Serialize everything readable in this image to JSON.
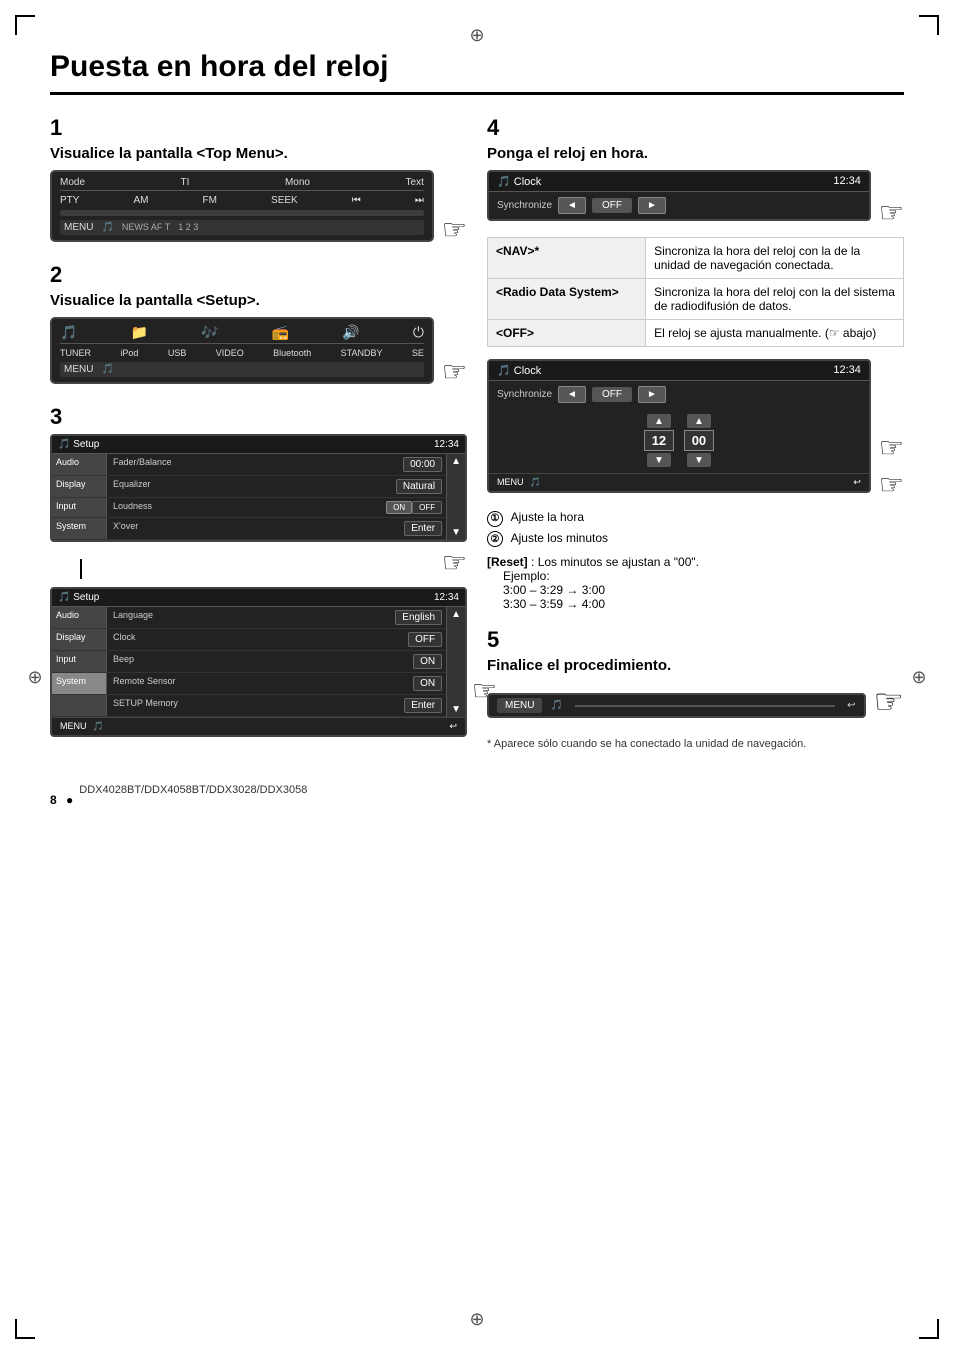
{
  "page": {
    "title": "Puesta en hora del reloj",
    "page_number": "8",
    "models": "DDX4028BT/DDX4058BT/DDX3028/DDX3058"
  },
  "step1": {
    "number": "1",
    "title": "Visualice la pantalla <Top Menu>.",
    "screen": {
      "top_items": [
        "Mode",
        "TI",
        "Mono",
        "Text"
      ],
      "radio_items": [
        "PTY",
        "AM",
        "FM",
        "SEEK",
        "⏮",
        "⏭"
      ],
      "bar_label": "MENU"
    }
  },
  "step2": {
    "number": "2",
    "title": "Visualice la pantalla <Setup>.",
    "screen": {
      "icons_row": [
        "🎵",
        "📁",
        "🎶",
        "📻",
        "🔊",
        "⏻"
      ],
      "bottom_items": [
        "TUNER",
        "iPod",
        "USB",
        "VIDEO",
        "Bluetooth",
        "STANDBY",
        "SE"
      ],
      "bar_label": "MENU"
    }
  },
  "step3": {
    "number": "3",
    "screen1": {
      "title": "Setup",
      "time": "12:34",
      "rows": [
        {
          "cat": "Audio",
          "item": "Fader/Balance",
          "val": "00:00"
        },
        {
          "cat": "Display",
          "item": "Equalizer",
          "val": "Natural"
        },
        {
          "cat": "Input",
          "item": "Loudness",
          "val": "ON/OFF"
        },
        {
          "cat": "System",
          "item": "X'over",
          "val": "Enter"
        }
      ]
    },
    "screen2": {
      "title": "Setup",
      "time": "12:34",
      "rows": [
        {
          "cat": "Audio",
          "item": "Language",
          "val": "English"
        },
        {
          "cat": "Display",
          "item": "Clock",
          "val": "OFF"
        },
        {
          "cat": "Input",
          "item": "Beep",
          "val": "ON"
        },
        {
          "cat": "System",
          "item": "Remote Sensor",
          "val": "ON"
        },
        {
          "cat": "",
          "item": "SETUP Memory",
          "val": "Enter"
        }
      ]
    }
  },
  "step4": {
    "number": "4",
    "title": "Ponga el reloj en hora.",
    "clock_screen1": {
      "label": "Clock",
      "time": "12:34",
      "sync_label": "Synchronize",
      "btn_left": "◄",
      "btn_off": "OFF",
      "btn_right": "►"
    },
    "table": {
      "rows": [
        {
          "key": "<NAV>*",
          "value": "Sincroniza la hora del reloj con la de la unidad de navegación conectada."
        },
        {
          "key": "<Radio Data System>",
          "value": "Sincroniza la hora del reloj con la del sistema de radiodifusión de datos."
        },
        {
          "key": "<OFF>",
          "value": "El reloj se ajusta manualmente. (☞ abajo)"
        }
      ]
    },
    "clock_screen2": {
      "label": "Clock",
      "time": "12:34",
      "sync_label": "Synchronize",
      "btn_left": "◄",
      "btn_off": "OFF",
      "btn_right": "►",
      "hour": "12",
      "minute": "00",
      "menu_label": "MENU"
    },
    "adjust_labels": [
      {
        "num": "①",
        "text": "Ajuste la hora"
      },
      {
        "num": "②",
        "text": "Ajuste los minutos"
      }
    ],
    "reset_block": {
      "label": "[Reset]:",
      "desc": "Los minutos se ajustan a \"00\".",
      "example_label": "Ejemplo:",
      "lines": [
        "3:00 – 3:29 → 3:00",
        "3:30 – 3:59 → 4:00"
      ]
    }
  },
  "step5": {
    "number": "5",
    "title": "Finalice el procedimiento.",
    "screen": {
      "menu_label": "MENU"
    }
  },
  "footnote": {
    "symbol": "*",
    "text": "Aparece sólo cuando se ha conectado la unidad de navegación."
  }
}
